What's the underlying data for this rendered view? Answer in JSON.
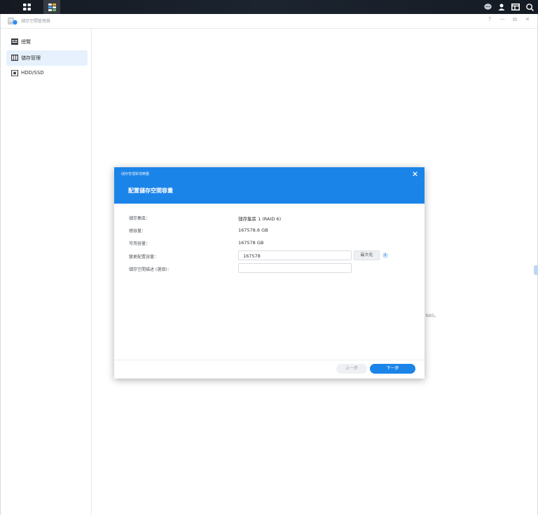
{
  "taskbar": {
    "icons": [
      "grid-menu-icon",
      "storage-manager-app-icon",
      "chat-icon",
      "user-icon",
      "widget-icon",
      "search-icon"
    ]
  },
  "window": {
    "title": "儲存空間管理員",
    "controls": {
      "help": "?",
      "minimize": "—",
      "restore": "⧉",
      "close": "✕"
    }
  },
  "sidebar": {
    "items": [
      {
        "label": "總覽",
        "icon": "overview-icon"
      },
      {
        "label": "儲存管理",
        "icon": "storage-icon"
      },
      {
        "label": "HDD/SSD",
        "icon": "disk-icon"
      }
    ],
    "active_index": 1
  },
  "background": {
    "partial_text": "y NAS。"
  },
  "dialog": {
    "wizard_title": "儲存管理新增精靈",
    "step_title": "配置儲存空間容量",
    "rows": {
      "pool": {
        "label": "儲存集區：",
        "value": "儲存集區 1 (RAID 6)"
      },
      "total": {
        "label": "總容量：",
        "value": "167578.6 GB"
      },
      "available": {
        "label": "可用容量：",
        "value": "167578 GB"
      },
      "allocate": {
        "label": "變更配置容量：",
        "value": "167578",
        "max_button": "最大化"
      },
      "description": {
        "label": "儲存空間描述 (選填)：",
        "value": ""
      }
    },
    "buttons": {
      "prev": "上一步",
      "next": "下一步"
    }
  },
  "colors": {
    "accent": "#1b84e8",
    "sidebar_active": "#e6f1fd"
  }
}
